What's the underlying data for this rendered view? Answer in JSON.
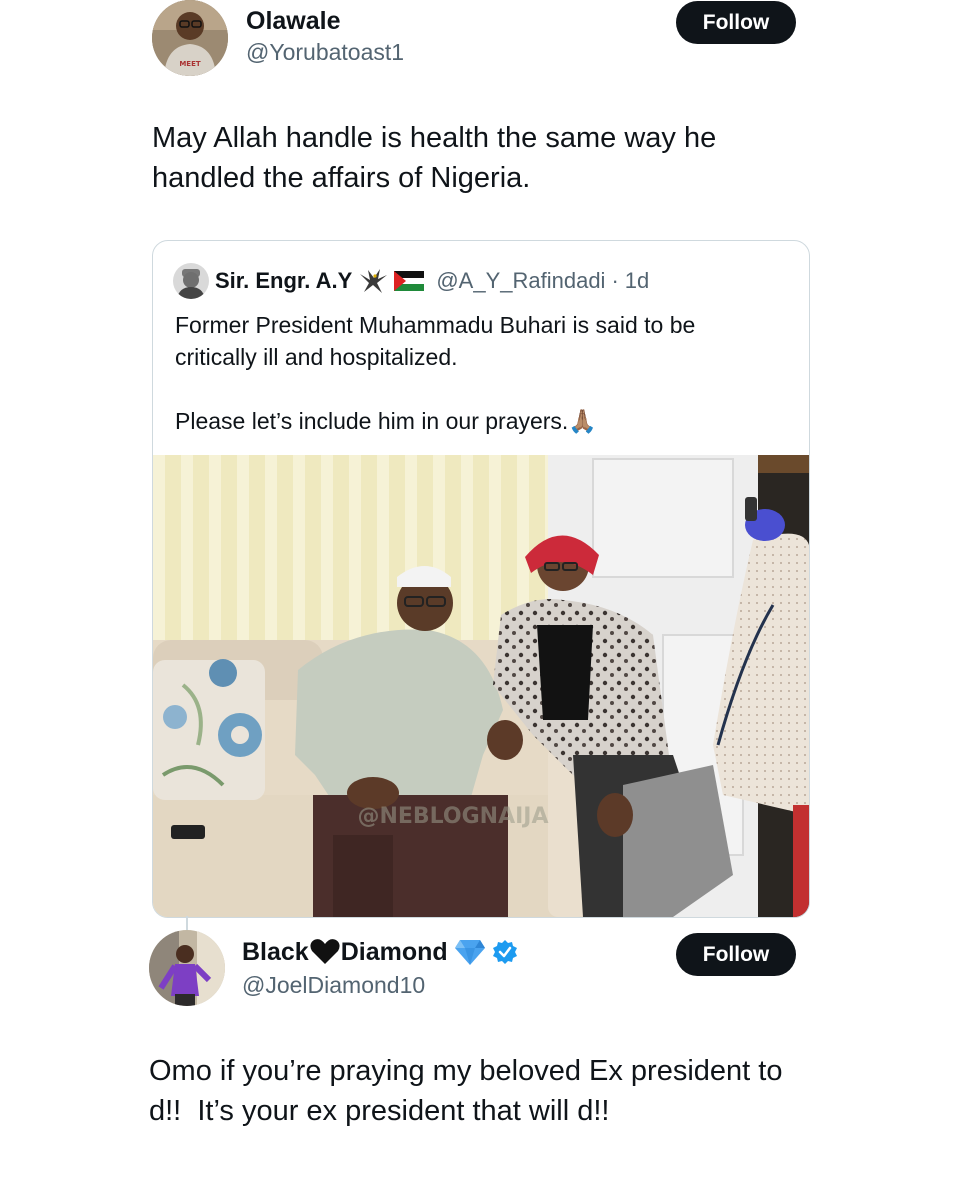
{
  "tweet1": {
    "display_name": "Olawale",
    "handle": "@Yorubatoast1",
    "follow_label": "Follow",
    "avatar_shirt_text": "MEET",
    "text_line1": "May Allah handle is health the same way he",
    "text_line2": "handled the affairs of Nigeria."
  },
  "quote": {
    "display_name": "Sir. Engr. A.Y",
    "handle": "@A_Y_Rafindadi",
    "separator": "·",
    "time": "1d",
    "text_line1": "Former President Muhammadu Buhari is said to be",
    "text_line2": "critically ill and hospitalized.",
    "text_line3": "Please let’s include him in our prayers.",
    "prayer_emoji": "🙏🏽",
    "eagle_icon": "eagle-icon",
    "flag_icon": "palestine-flag-icon",
    "watermark": "@NEBLOGNAIJA"
  },
  "tweet2": {
    "display_name_part1": "Black",
    "display_name_part2": "Diamond",
    "handle": "@JoelDiamond10",
    "follow_label": "Follow",
    "text_line1": "Omo if you’re praying my beloved Ex president to",
    "text_line2": "d!!  It’s your ex president that will d!!",
    "icons": [
      "black-heart-icon",
      "diamond-icon",
      "verified-badge-icon"
    ]
  },
  "colors": {
    "follow_bg": "#0f1419",
    "secondary_text": "#536471",
    "border": "#cfd9de",
    "verified_blue": "#1d9bf0",
    "diamond_blue": "#4aa3ef"
  }
}
